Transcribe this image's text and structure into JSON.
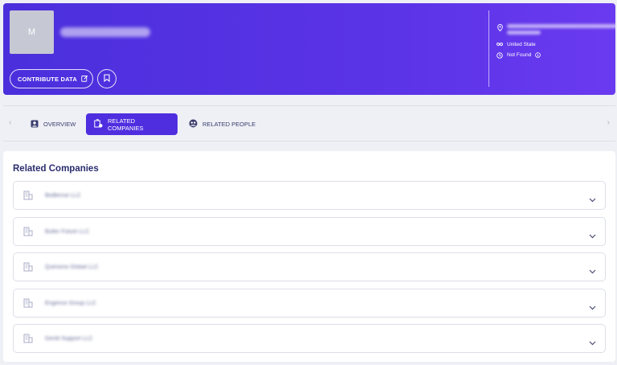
{
  "header": {
    "avatar_initial": "M",
    "contribute_label": "CONTRIBUTE DATA",
    "info": {
      "country": "United State",
      "status": "Not Found"
    }
  },
  "tabs": [
    {
      "label": "OVERVIEW",
      "icon": "person-badge-icon",
      "active": false
    },
    {
      "label": "RELATED COMPANIES",
      "icon": "building-icon",
      "active": true
    },
    {
      "label": "RELATED PEOPLE",
      "icon": "people-icon",
      "active": false
    }
  ],
  "main": {
    "section_title": "Related Companies",
    "companies": [
      {
        "name": "BioBense LLC"
      },
      {
        "name": "Butler Future LLC"
      },
      {
        "name": "Quimonix Global LLC"
      },
      {
        "name": "Engence Group LLC"
      },
      {
        "name": "Gentil Support LLC"
      }
    ]
  },
  "colors": {
    "accent": "#4f2ee0",
    "header_gradient_start": "#4b2fdc",
    "header_gradient_end": "#6a3af0",
    "text_primary": "#2b2d6e"
  }
}
